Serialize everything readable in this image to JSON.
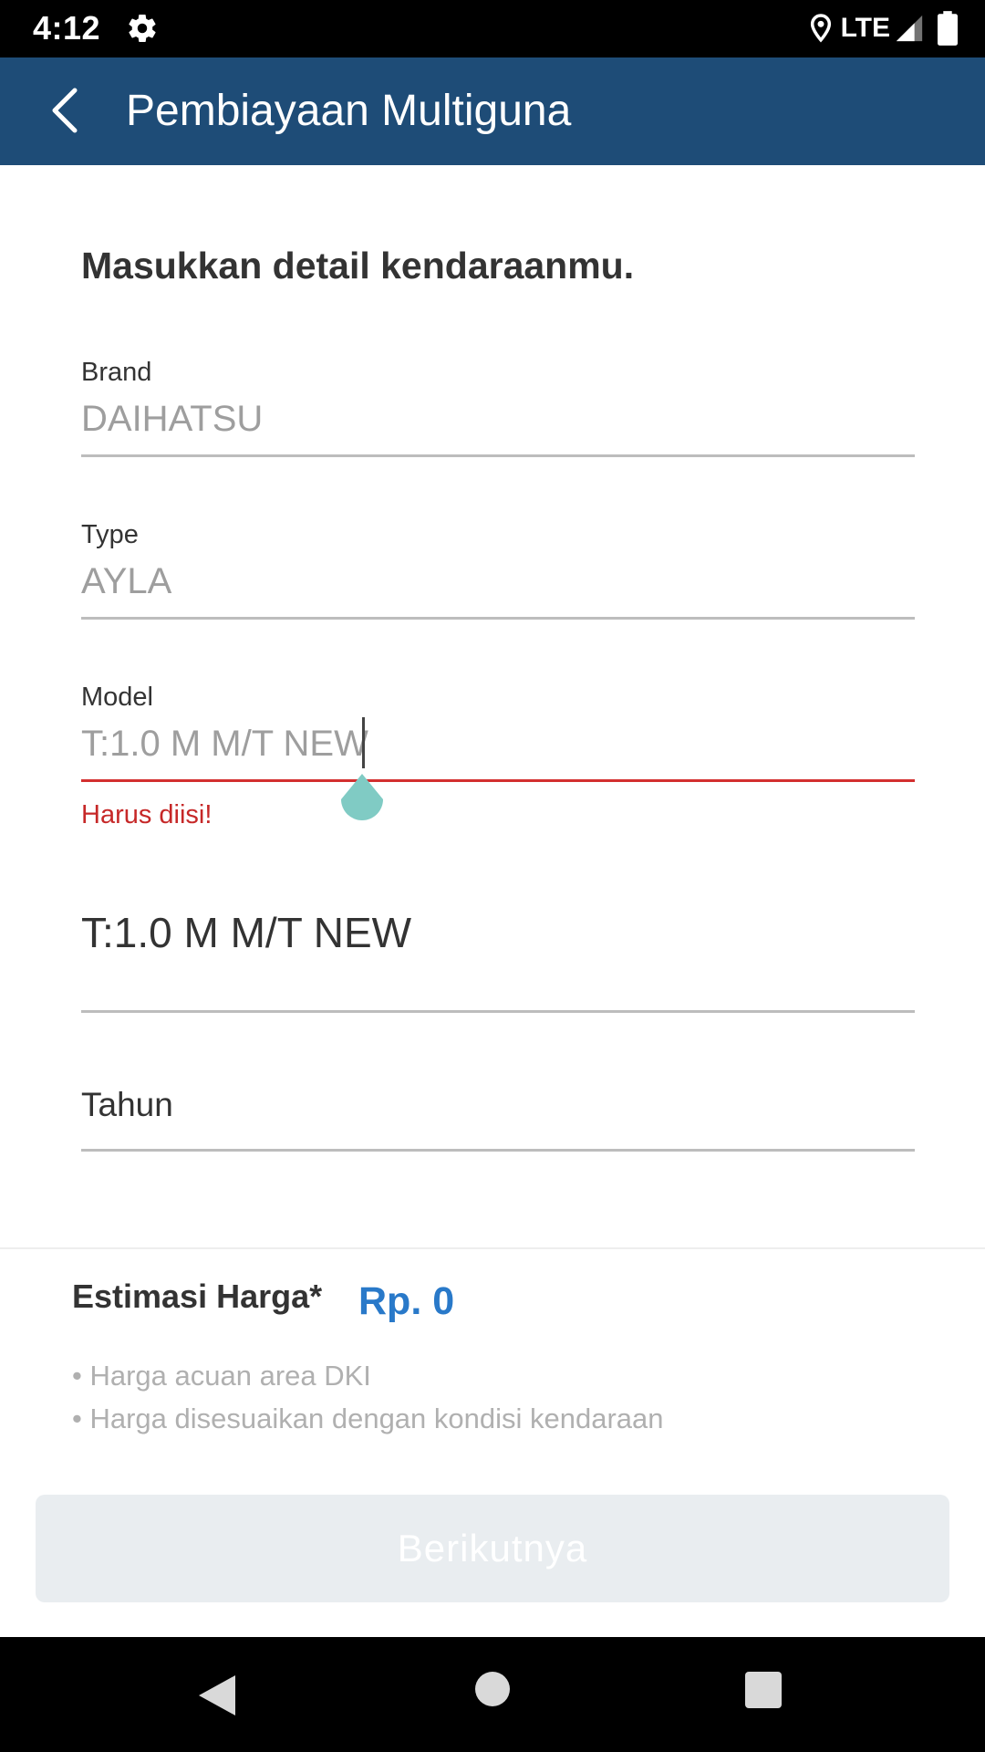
{
  "status_bar": {
    "time": "4:12",
    "network": "LTE",
    "icons": [
      "gear-icon",
      "location-icon",
      "signal-icon",
      "battery-icon"
    ]
  },
  "app_bar": {
    "title": "Pembiayaan Multiguna",
    "back_icon": "chevron-left-icon",
    "background_color": "#1e4c77"
  },
  "form": {
    "heading": "Masukkan detail kendaraanmu.",
    "brand": {
      "label": "Brand",
      "value": "DAIHATSU"
    },
    "type": {
      "label": "Type",
      "value": "AYLA"
    },
    "model": {
      "label": "Model",
      "value": "T:1.0 M M/T NEW",
      "error": "Harus diisi!"
    },
    "model_selected": "T:1.0 M M/T NEW",
    "tahun": {
      "placeholder": "Tahun"
    }
  },
  "estimate": {
    "label": "Estimasi Harga*",
    "value": "Rp. 0",
    "value_color": "#2979c9",
    "notes": [
      "• Harga acuan area DKI",
      "• Harga disesuaikan dengan kondisi kendaraan"
    ]
  },
  "actions": {
    "next_label": "Berikutnya",
    "next_enabled": false
  },
  "colors": {
    "error": "#d32f2f",
    "handle": "#80cbc4"
  }
}
